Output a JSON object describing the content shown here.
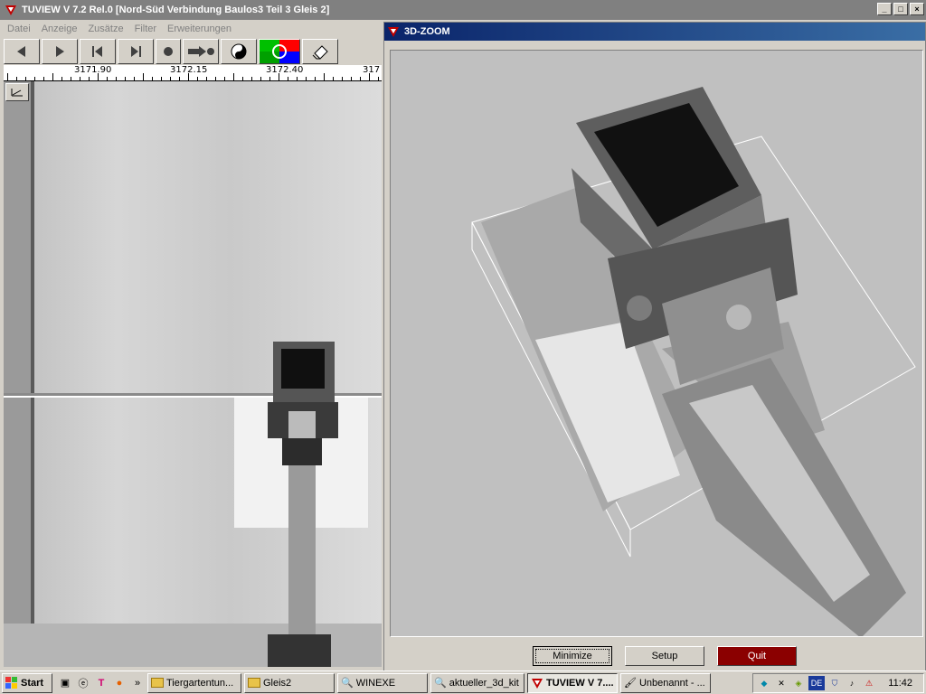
{
  "main_window": {
    "title": "TUVIEW V 7.2 Rel.0 [Nord-Süd Verbindung Baulos3 Teil 3 Gleis 2]",
    "menu": [
      "Datei",
      "Anzeige",
      "Zusätze",
      "Filter",
      "Erweiterungen"
    ],
    "toolbar": [
      "prev-icon",
      "play-icon",
      "skip-first-icon",
      "skip-last-icon",
      "stop-icon",
      "record-icon",
      "yin-yang-icon",
      "color-wheel-icon",
      "eraser-icon"
    ],
    "ruler": [
      "3171.90",
      "3172.15",
      "3172.40",
      "317"
    ]
  },
  "zoom_window": {
    "title": "3D-ZOOM",
    "buttons": {
      "minimize": "Minimize",
      "setup": "Setup",
      "quit": "Quit"
    }
  },
  "taskbar": {
    "start": "Start",
    "tasks": [
      "Tiergartentun...",
      "Gleis2",
      "WINEXE",
      "aktueller_3d_kit",
      "TUVIEW V 7....",
      "Unbenannt - ..."
    ],
    "tray_lang": "DE",
    "clock": "11:42"
  },
  "colors": {
    "title_inactive": "#808080",
    "title_active": "#0a246a",
    "quit": "#8b0000",
    "face": "#d4d0c8"
  }
}
